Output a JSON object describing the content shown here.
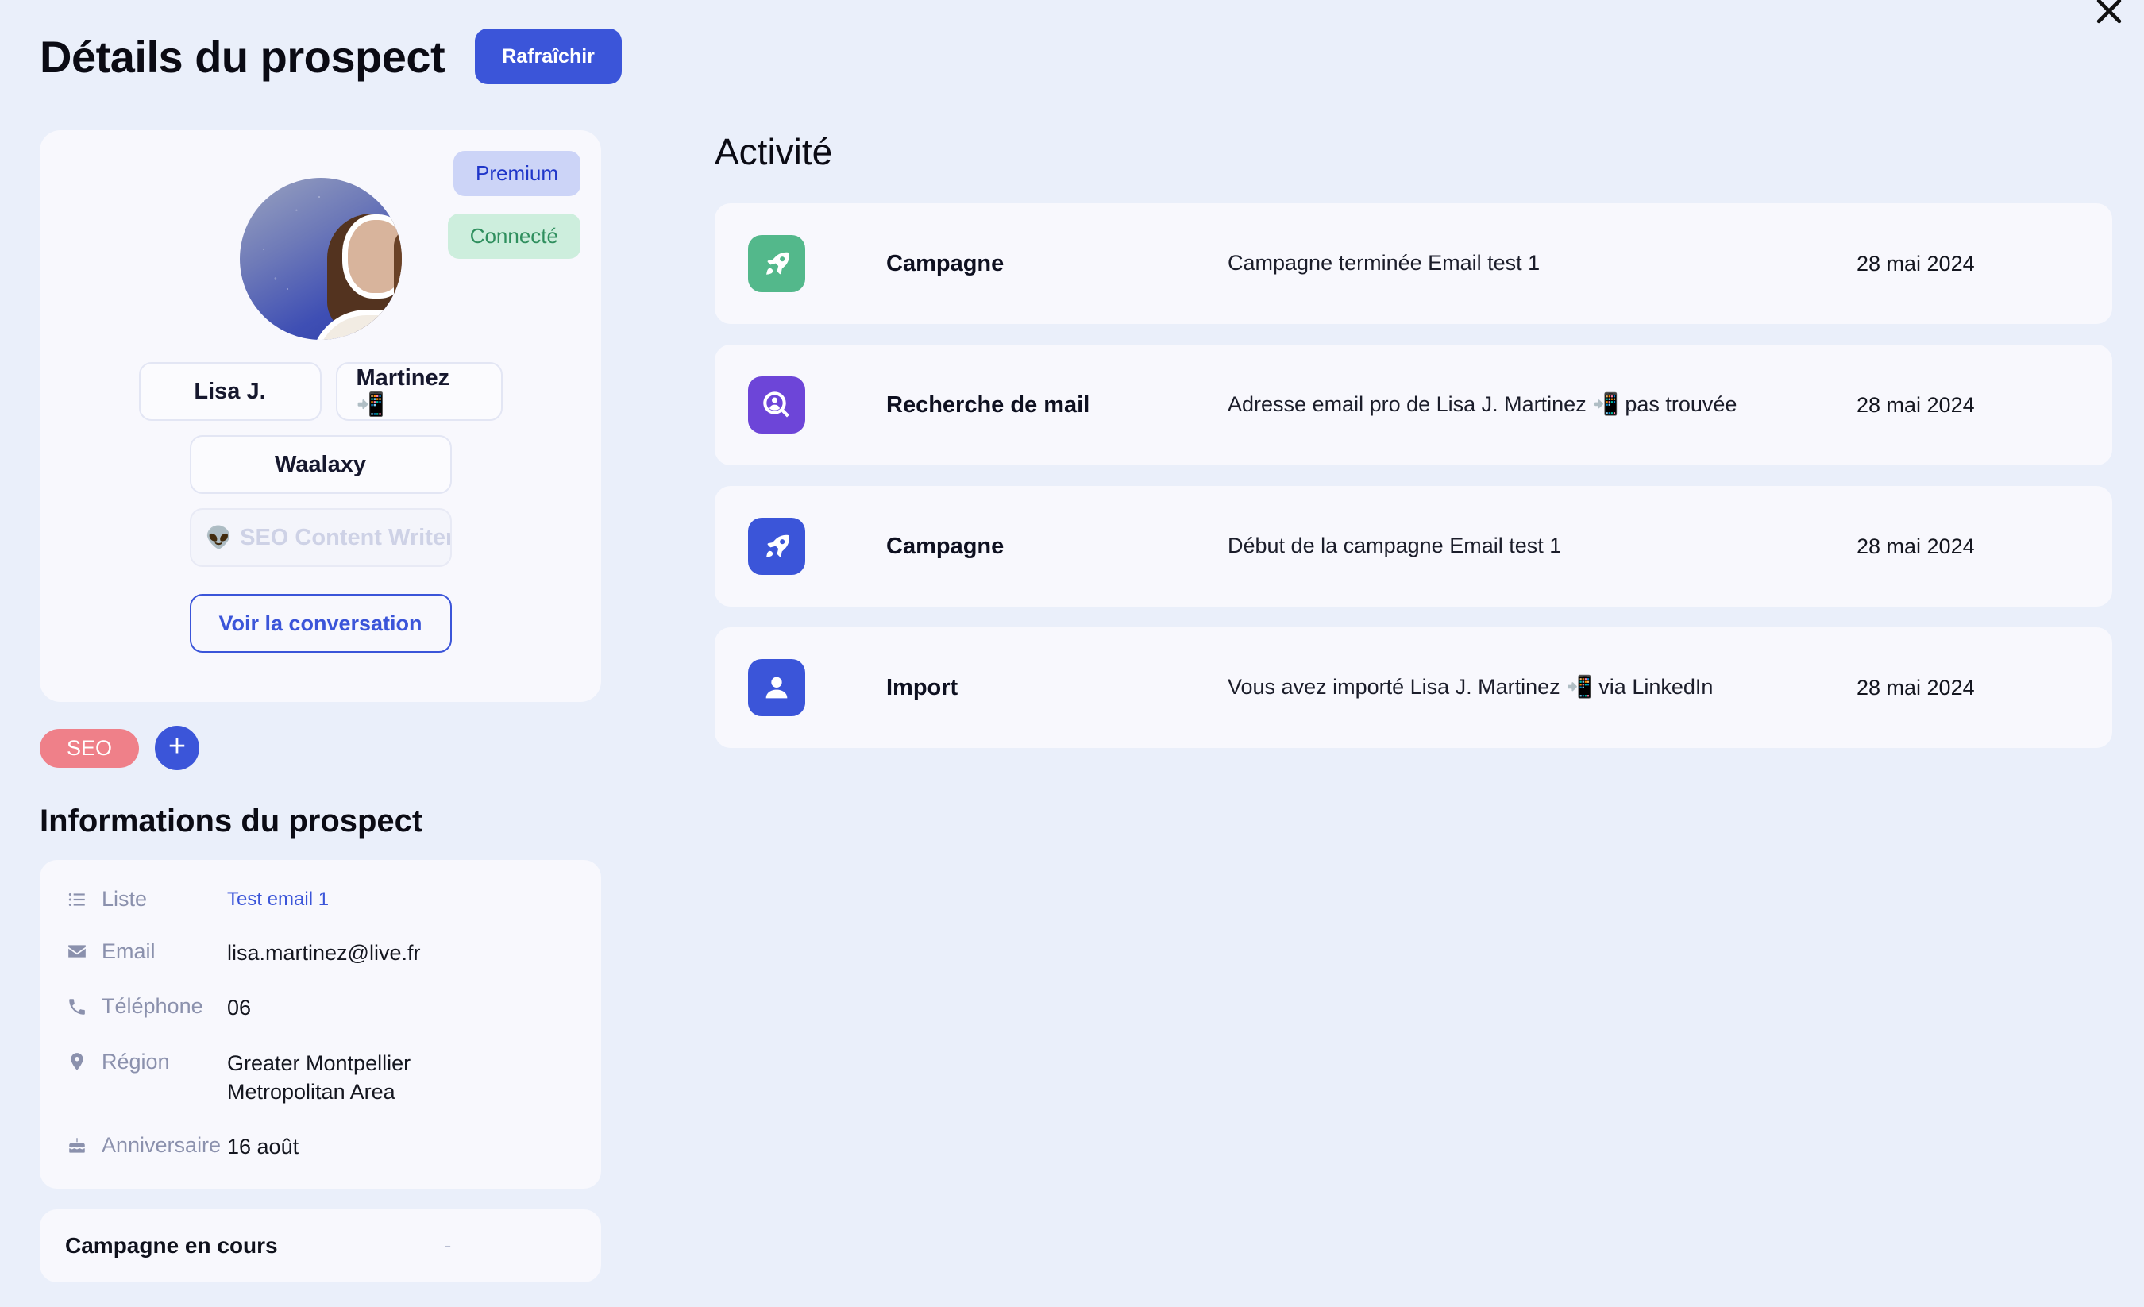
{
  "header": {
    "title": "Détails du prospect",
    "refresh_label": "Rafraîchir",
    "close_icon": "close-icon"
  },
  "profile": {
    "badges": {
      "premium": "Premium",
      "connected": "Connecté"
    },
    "avatar_alt": "Lisa J. Martinez",
    "first_name": "Lisa J.",
    "last_name": "Martinez 📲",
    "company": "Waalaxy",
    "job_title": "SEO Content Writer &",
    "job_title_emoji": "👽",
    "conversation_button": "Voir la conversation",
    "tags": [
      "SEO"
    ],
    "add_tag_label": "+"
  },
  "info": {
    "section_title": "Informations du prospect",
    "rows": [
      {
        "icon": "list-icon",
        "label": "Liste",
        "value": "Test email 1",
        "is_link": true
      },
      {
        "icon": "envelope-icon",
        "label": "Email",
        "value": "lisa.martinez@live.fr",
        "is_link": false
      },
      {
        "icon": "phone-icon",
        "label": "Téléphone",
        "value": "06",
        "is_link": false
      },
      {
        "icon": "location-icon",
        "label": "Région",
        "value": "Greater Montpellier Metropolitan Area",
        "is_link": false
      },
      {
        "icon": "cake-icon",
        "label": "Anniversaire",
        "value": "16 août",
        "is_link": false
      }
    ]
  },
  "campaign": {
    "label": "Campagne en cours",
    "value": "-"
  },
  "activity": {
    "title": "Activité",
    "rows": [
      {
        "icon": "rocket-icon",
        "icon_color": "#53b88b",
        "type": "Campagne",
        "description": "Campagne terminée Email test 1",
        "date": "28 mai 2024"
      },
      {
        "icon": "person-search-icon",
        "icon_color": "#6d45d8",
        "type": "Recherche de mail",
        "description": "Adresse email pro de Lisa J. Martinez 📲 pas trouvée",
        "date": "28 mai 2024"
      },
      {
        "icon": "rocket-icon",
        "icon_color": "#3b55d9",
        "type": "Campagne",
        "description": "Début de la campagne Email test 1",
        "date": "28 mai 2024"
      },
      {
        "icon": "person-icon",
        "icon_color": "#3b55d9",
        "type": "Import",
        "description": "Vous avez importé Lisa J. Martinez 📲 via LinkedIn",
        "date": "28 mai 2024"
      }
    ]
  },
  "colors": {
    "background": "#eaeffa",
    "card": "#f8f8fd",
    "accent": "#3b55d9",
    "tag": "#ef8089",
    "premium_bg": "#ccd4f7",
    "premium_text": "#2036c9",
    "connected_bg": "#cdeedd",
    "connected_text": "#2f8f5e"
  }
}
